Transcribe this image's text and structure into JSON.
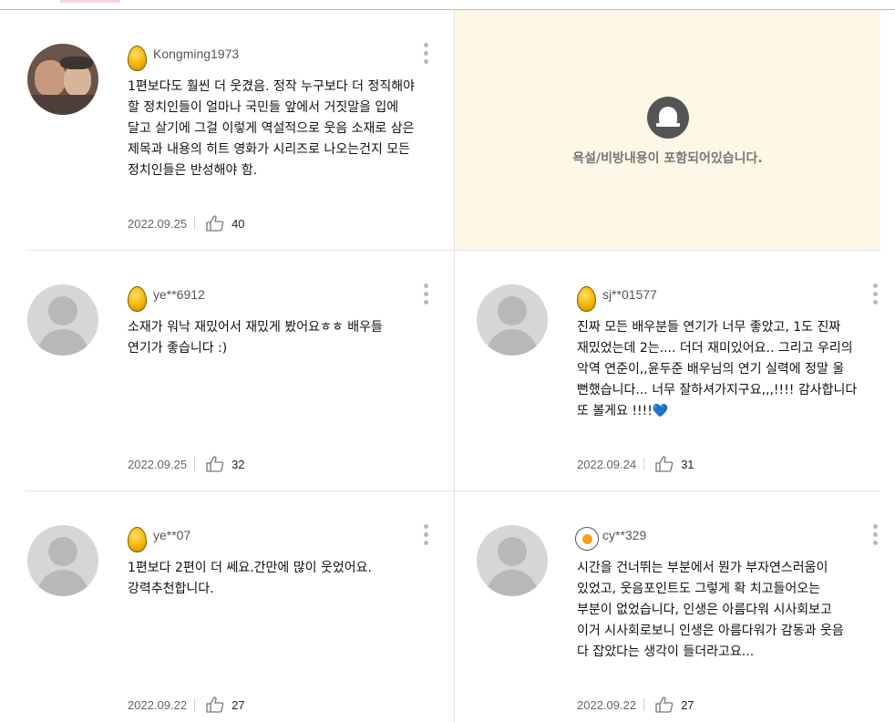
{
  "comments": [
    {
      "user": "Kongming1973",
      "badge": "gold-egg-icon",
      "avatar": "photo",
      "text": "1편보다도 훨씬 더 웃겼음. 정작 누구보다 더 정직해야 할 정치인들이 얼마나 국민들 앞에서 거짓말을 입에 달고 살기에 그걸 이렇게 역설적으로 웃음 소재로 삼은 제목과 내용의 히트 영화가 시리즈로 나오는건지 모든 정치인들은 반성해야 함.",
      "date": "2022.09.25",
      "likes": "40"
    },
    {
      "blocked": true,
      "blocked_icon": "alert-bell-icon",
      "blocked_message": "욕설/비방내용이 포함되어있습니다."
    },
    {
      "user": "ye**6912",
      "badge": "gold-egg-icon",
      "avatar": "default",
      "text": "소재가 워낙 재밌어서 재밌게 봤어요ㅎㅎ 배우들 연기가 좋습니다 :)",
      "date": "2022.09.25",
      "likes": "32"
    },
    {
      "user": "sj**01577",
      "badge": "gold-egg-icon",
      "avatar": "default",
      "text": "진짜 모든 배우분들 연기가 너무 좋았고, 1도 진짜 재밌었는데 2는.... 더더 재미있어요.. 그리고 우리의 악역 연준이,,윤두준 배우님의 연기 실력에 정말 울 뻔했습니다... 너무 잘하셔가지구요,,,!!!! 감사합니다 또 볼게요 !!!!💙",
      "date": "2022.09.24",
      "likes": "31"
    },
    {
      "user": "ye**07",
      "badge": "gold-egg-icon",
      "avatar": "default",
      "text": "1편보다 2편이 더 쎄요.간만에 많이 웃었어요. 강력추천합니다.",
      "date": "2022.09.22",
      "likes": "27"
    },
    {
      "user": "cy**329",
      "badge": "fried-egg-icon",
      "avatar": "default",
      "text": "시간을 건너뛰는 부분에서 뭔가 부자연스러움이 있었고, 웃음포인트도 그렇게 확 치고들어오는 부분이 없었습니다, 인생은 아름다워 시사회보고 이거 시사회로보니 인생은 아름다워가 감동과 웃음 다 잡았다는 생각이 들더라고요...",
      "date": "2022.09.22",
      "likes": "27"
    }
  ],
  "colors": {
    "blocked_bg": "#fdf8e6",
    "divider": "#e4e4e4",
    "egg_gold": "#f4b400"
  }
}
